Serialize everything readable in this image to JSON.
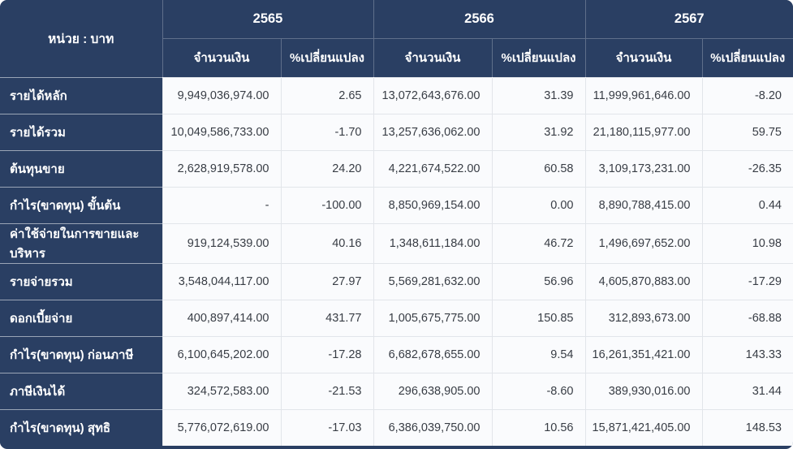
{
  "table": {
    "unit_label": "หน่วย : บาท",
    "year_groups": [
      {
        "year": "2565"
      },
      {
        "year": "2566"
      },
      {
        "year": "2567"
      }
    ],
    "sub_headers": {
      "amount": "จำนวนเงิน",
      "change": "%เปลี่ยนแปลง"
    },
    "rows": [
      {
        "label": "รายได้หลัก",
        "values": [
          "9,949,036,974.00",
          "2.65",
          "13,072,643,676.00",
          "31.39",
          "11,999,961,646.00",
          "-8.20"
        ]
      },
      {
        "label": "รายได้รวม",
        "values": [
          "10,049,586,733.00",
          "-1.70",
          "13,257,636,062.00",
          "31.92",
          "21,180,115,977.00",
          "59.75"
        ]
      },
      {
        "label": "ต้นทุนขาย",
        "values": [
          "2,628,919,578.00",
          "24.20",
          "4,221,674,522.00",
          "60.58",
          "3,109,173,231.00",
          "-26.35"
        ]
      },
      {
        "label": "กำไร(ขาดทุน) ขั้นต้น",
        "values": [
          "-",
          "-100.00",
          "8,850,969,154.00",
          "0.00",
          "8,890,788,415.00",
          "0.44"
        ]
      },
      {
        "label": "ค่าใช้จ่ายในการขายและบริหาร",
        "values": [
          "919,124,539.00",
          "40.16",
          "1,348,611,184.00",
          "46.72",
          "1,496,697,652.00",
          "10.98"
        ]
      },
      {
        "label": "รายจ่ายรวม",
        "values": [
          "3,548,044,117.00",
          "27.97",
          "5,569,281,632.00",
          "56.96",
          "4,605,870,883.00",
          "-17.29"
        ]
      },
      {
        "label": "ดอกเบี้ยจ่าย",
        "values": [
          "400,897,414.00",
          "431.77",
          "1,005,675,775.00",
          "150.85",
          "312,893,673.00",
          "-68.88"
        ]
      },
      {
        "label": "กำไร(ขาดทุน) ก่อนภาษี",
        "values": [
          "6,100,645,202.00",
          "-17.28",
          "6,682,678,655.00",
          "9.54",
          "16,261,351,421.00",
          "143.33"
        ]
      },
      {
        "label": "ภาษีเงินได้",
        "values": [
          "324,572,583.00",
          "-21.53",
          "296,638,905.00",
          "-8.60",
          "389,930,016.00",
          "31.44"
        ]
      },
      {
        "label": "กำไร(ขาดทุน) สุทธิ",
        "values": [
          "5,776,072,619.00",
          "-17.03",
          "6,386,039,750.00",
          "10.56",
          "15,871,421,405.00",
          "148.53"
        ]
      }
    ],
    "colors": {
      "header_navy": "#2a3f63",
      "row_background": "#fafbfd",
      "border_light": "#e2e5ea",
      "header_text": "#ffffff",
      "data_text": "#383d45"
    }
  }
}
